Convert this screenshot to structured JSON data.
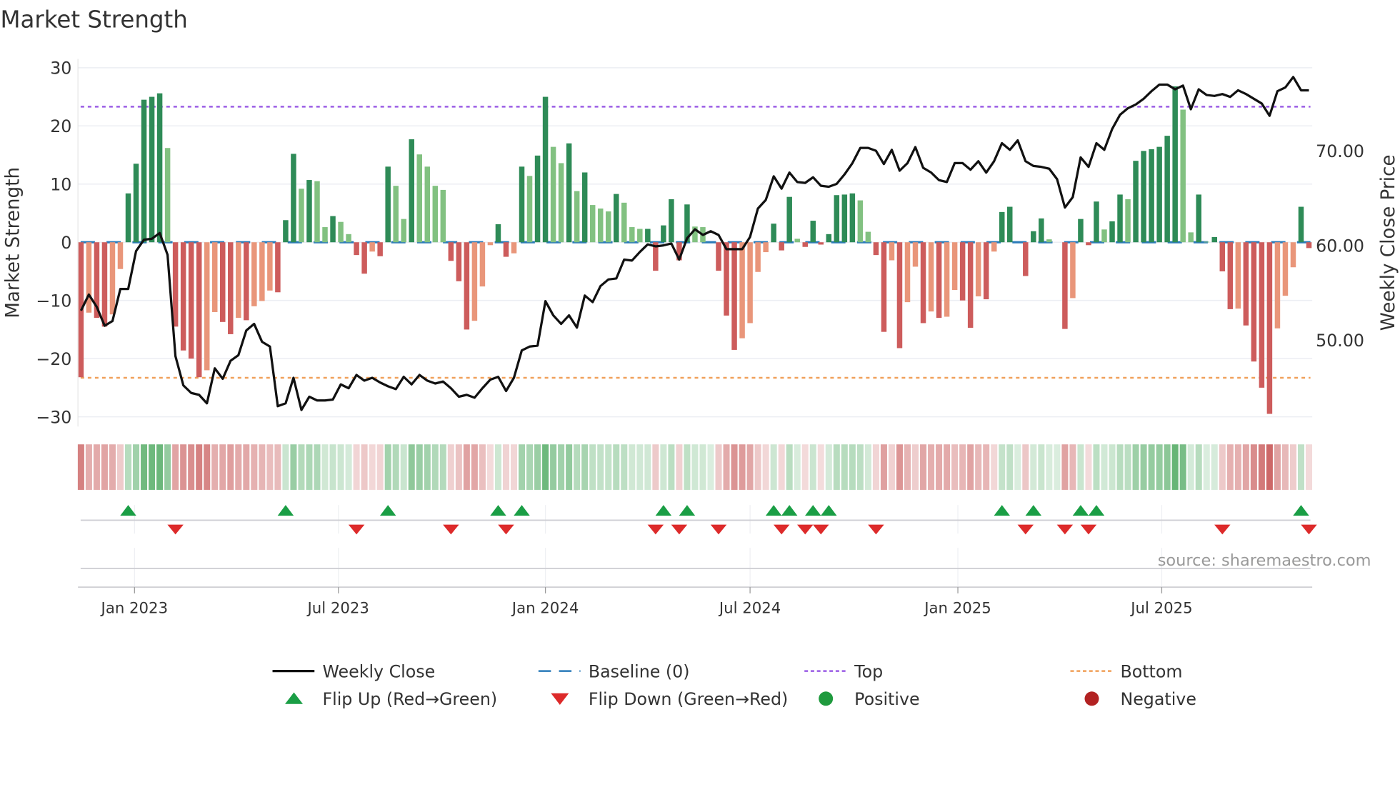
{
  "chart_data": {
    "type": "bar",
    "title": "Market Strength",
    "ylabel": "Market Strength",
    "y2label": "Weekly Close Price",
    "ylim": [
      -31.5,
      31.5
    ],
    "y2lim": [
      41.5,
      80
    ],
    "interval": "weekly",
    "yticks": [
      {
        "v": 30,
        "label": "30"
      },
      {
        "v": 20,
        "label": "20"
      },
      {
        "v": 10,
        "label": "10"
      },
      {
        "v": 0,
        "label": "0"
      },
      {
        "v": -10,
        "label": "−10"
      },
      {
        "v": -20,
        "label": "−20"
      },
      {
        "v": -30,
        "label": "−30"
      }
    ],
    "y2ticks": [
      {
        "v": 70,
        "label": "70.00"
      },
      {
        "v": 60,
        "label": "60.00"
      },
      {
        "v": 50,
        "label": "50.00"
      }
    ],
    "xticks": [
      {
        "week": 6.8,
        "label": "Jan 2023"
      },
      {
        "week": 32.7,
        "label": "Jul 2023"
      },
      {
        "week": 59.0,
        "label": "Jan 2024"
      },
      {
        "week": 85.0,
        "label": "Jul 2024"
      },
      {
        "week": 111.4,
        "label": "Jan 2025"
      },
      {
        "week": 137.3,
        "label": "Jul 2025"
      }
    ],
    "top_level": 23.3,
    "bottom_level": -23.3,
    "baseline": 0,
    "strength": [
      -23.2,
      -12.1,
      -13,
      -14.5,
      -12.4,
      -4.6,
      8.4,
      13.5,
      24.5,
      25,
      25.6,
      16.2,
      -14.5,
      -18.6,
      -20,
      -23.2,
      -22,
      -12,
      -13.7,
      -15.8,
      -13,
      -13.4,
      -11,
      -10.1,
      -8.3,
      -8.6,
      3.8,
      15.2,
      9.2,
      10.7,
      10.5,
      2.6,
      4.5,
      3.5,
      1.4,
      -2.2,
      -5.4,
      -1.6,
      -2.4,
      13,
      9.7,
      4,
      17.7,
      15.1,
      13,
      9.7,
      9,
      -3.2,
      -6.7,
      -15,
      -13.5,
      -7.6,
      -0.5,
      3.1,
      -2.5,
      -1.9,
      13,
      11.4,
      14.9,
      25,
      16.4,
      13.6,
      17,
      8.8,
      12,
      6.4,
      5.8,
      5.3,
      8.3,
      6.8,
      2.6,
      2.3,
      2.3,
      -4.9,
      2.9,
      7.4,
      -3.1,
      6.5,
      2.7,
      2.6,
      0,
      -4.9,
      -12.6,
      -18.5,
      -16.5,
      -13.9,
      -5.1,
      -1.7,
      3.2,
      -1.4,
      7.8,
      0.6,
      -0.8,
      3.7,
      -0.4,
      1.4,
      8.1,
      8.2,
      8.4,
      7.2,
      1.8,
      -2.2,
      -15.4,
      -3.1,
      -18.2,
      -10.3,
      -4.2,
      -13.9,
      -11.9,
      -13,
      -12.8,
      -8.2,
      -10,
      -14.7,
      -9.3,
      -9.8,
      -1.6,
      5.2,
      6.1,
      0,
      -5.8,
      1.9,
      4.1,
      0.5,
      0,
      -14.9,
      -9.6,
      4,
      -0.5,
      7,
      2.2,
      3.6,
      8.2,
      7.4,
      14,
      15.7,
      16,
      16.4,
      18.3,
      26.8,
      22.8,
      1.7,
      8.2,
      0.1,
      0.9,
      -5,
      -11.5,
      -11.4,
      -14.3,
      -20.5,
      -25,
      -29.5,
      -14.8,
      -9.2,
      -4.3,
      6.1,
      -1
    ],
    "weekly_close": [
      53.1,
      54.8,
      53.5,
      51.5,
      52,
      55.4,
      55.4,
      59.4,
      60.6,
      60.7,
      61.3,
      59,
      48.3,
      45.2,
      44.4,
      44.2,
      43.3,
      47,
      45.9,
      47.8,
      48.4,
      51,
      51.7,
      49.8,
      49.3,
      43,
      43.3,
      46,
      42.6,
      44,
      43.6,
      43.6,
      43.7,
      45.3,
      44.9,
      46.3,
      45.7,
      46,
      45.5,
      45.1,
      44.8,
      46.1,
      45.3,
      46.3,
      45.7,
      45.4,
      45.6,
      44.9,
      44,
      44.2,
      43.9,
      44.9,
      45.8,
      46.1,
      44.6,
      46,
      48.9,
      49.3,
      49.4,
      54.1,
      52.6,
      51.7,
      52.6,
      51.3,
      54.7,
      54,
      55.7,
      56.4,
      56.5,
      58.5,
      58.4,
      59.3,
      60.1,
      59.9,
      60,
      60.2,
      58.5,
      60.75,
      61.7,
      61.1,
      61.5,
      61.1,
      59.6,
      59.6,
      59.6,
      60.9,
      63.9,
      64.8,
      67.3,
      66,
      67.7,
      66.7,
      66.6,
      67.2,
      66.3,
      66.2,
      66.5,
      67.5,
      68.7,
      70.3,
      70.3,
      70,
      68.6,
      70.1,
      67.9,
      68.7,
      70.4,
      68.2,
      67.7,
      66.9,
      66.7,
      68.7,
      68.7,
      68,
      68.9,
      67.7,
      68.9,
      70.8,
      70.1,
      71.1,
      68.9,
      68.4,
      68.3,
      68.1,
      67,
      64,
      65.1,
      69.3,
      68.3,
      70.8,
      70.1,
      72.3,
      73.8,
      74.5,
      74.9,
      75.5,
      76.3,
      77,
      77,
      76.5,
      76.9,
      74.4,
      76.5,
      75.9,
      75.8,
      76,
      75.7,
      76.4,
      76,
      75.5,
      75,
      73.7,
      76.3,
      76.7,
      77.8,
      76.4,
      76.4
    ],
    "flips_up": [
      6,
      26,
      39,
      53,
      56,
      74,
      77,
      88,
      90,
      93,
      95,
      117,
      121,
      127,
      129,
      155
    ],
    "flips_down": [
      12,
      35,
      47,
      54,
      73,
      76,
      81,
      89,
      92,
      94,
      101,
      120,
      125,
      128,
      145,
      156
    ],
    "legend": {
      "placement": "bottom",
      "items": [
        {
          "key": "close",
          "label": "Weekly Close"
        },
        {
          "key": "baseline",
          "label": "Baseline (0)"
        },
        {
          "key": "top",
          "label": "Top"
        },
        {
          "key": "bottom",
          "label": "Bottom"
        },
        {
          "key": "flip_up",
          "label": "Flip Up (Red→Green)"
        },
        {
          "key": "flip_down",
          "label": "Flip Down (Green→Red)"
        },
        {
          "key": "positive",
          "label": "Positive"
        },
        {
          "key": "negative",
          "label": "Negative"
        }
      ]
    },
    "source": "source: sharemaestro.com"
  },
  "colors": {
    "pos_dark": "#2e8b57",
    "pos_light": "#82c181",
    "neg_dark": "#cd5c5c",
    "neg_light": "#e9967a",
    "close": "#111111",
    "baseline": "#2b7bb9",
    "top": "#9b5de5",
    "bottom": "#f0a05a",
    "flip_up": "#1a9e45",
    "flip_down": "#dd2a2a",
    "positive": "#1f9a3e",
    "negative": "#b22222"
  }
}
